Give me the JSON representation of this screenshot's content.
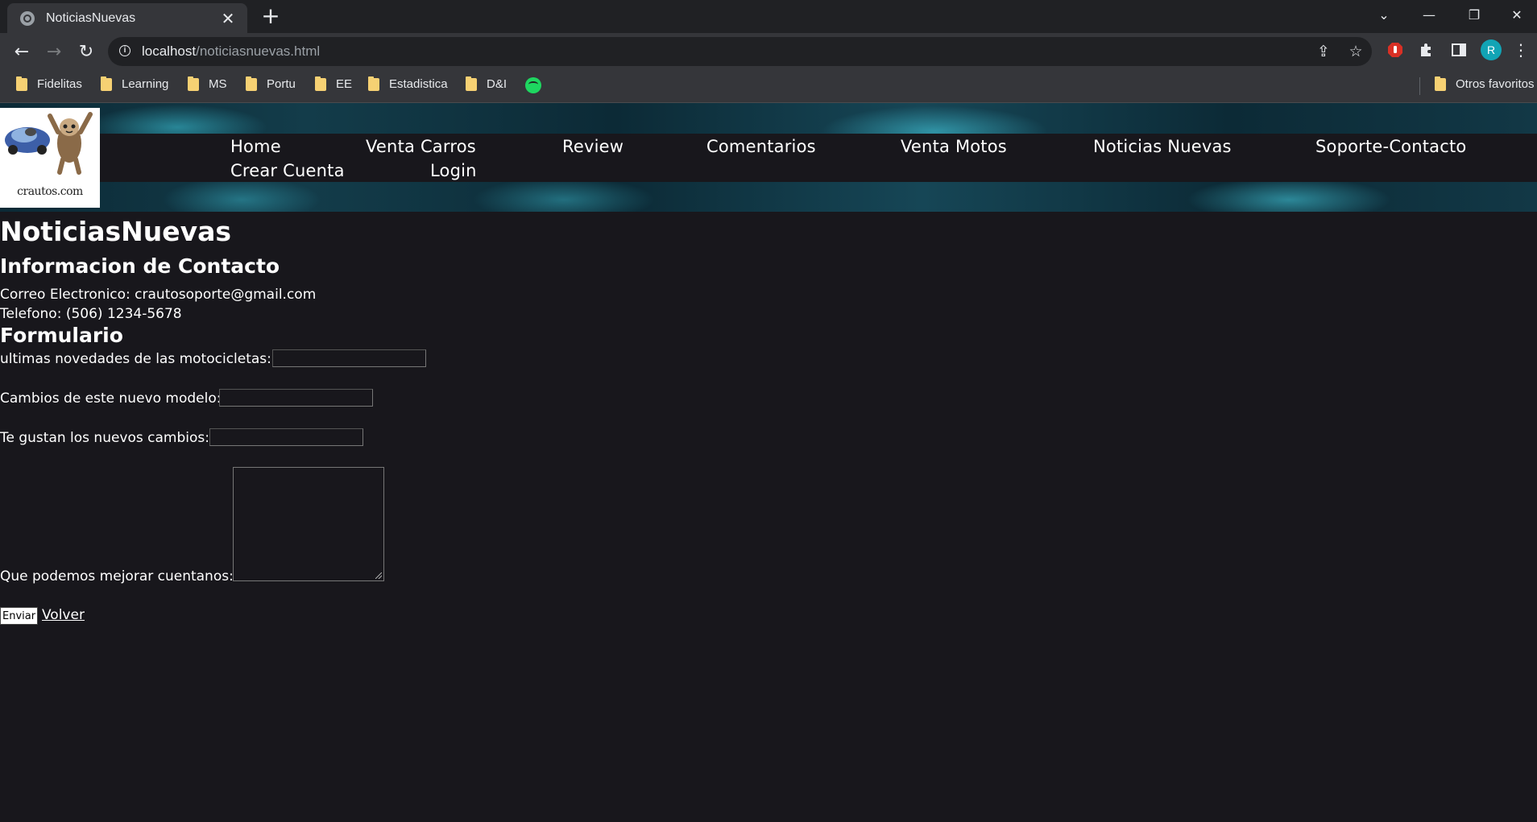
{
  "browser": {
    "tab_title": "NoticiasNuevas",
    "url_host": "localhost",
    "url_path": "/noticiasnuevas.html",
    "profile_initial": "R",
    "bookmarks": [
      "Fidelitas",
      "Learning",
      "MS",
      "Portu",
      "EE",
      "Estadistica",
      "D&I"
    ],
    "other_bookmarks": "Otros favoritos"
  },
  "site": {
    "logo_text": "crautos.com",
    "nav": {
      "home": "Home",
      "venta_carros": "Venta Carros",
      "review": "Review",
      "comentarios": "Comentarios",
      "venta_motos": "Venta Motos",
      "noticias_nuevas": "Noticias Nuevas",
      "soporte_contacto": "Soporte-Contacto",
      "crear_cuenta": "Crear Cuenta",
      "login": "Login"
    }
  },
  "main": {
    "title": "NoticiasNuevas",
    "contact_heading": "Informacion de Contacto",
    "email_line": "Correo Electronico: crautosoporte@gmail.com",
    "phone_line": "Telefono: (506) 1234-5678",
    "form_heading": "Formulario",
    "form": {
      "field1_label": "ultimas novedades de las motocicletas:",
      "field2_label": "Cambios de este nuevo modelo:",
      "field3_label": "Te gustan los nuevos cambios:",
      "field4_label": "Que podemos mejorar cuentanos:",
      "submit_label": "Enviar",
      "back_label": "Volver"
    }
  },
  "colors": {
    "page_background": "#18171c",
    "text": "#ffffff",
    "banner": "#133c4a"
  }
}
